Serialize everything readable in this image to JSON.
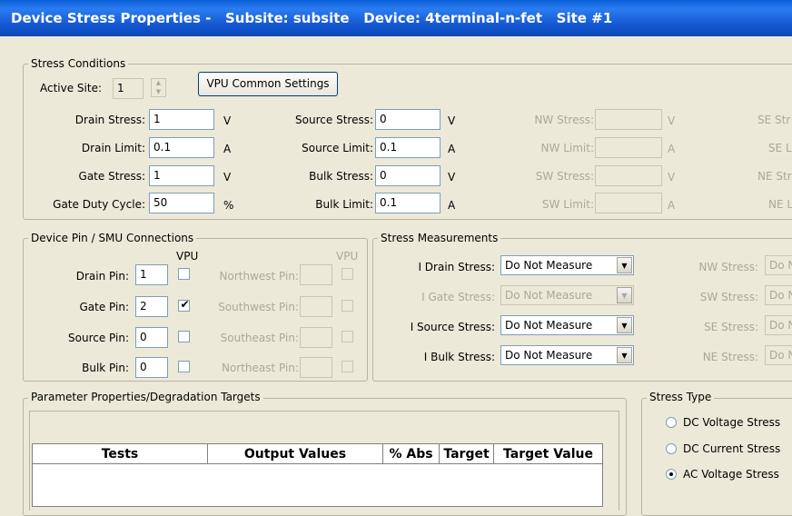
{
  "window": {
    "title": "Device Stress Properties -   Subsite: subsite   Device: 4terminal-n-fet   Site #1"
  },
  "stress_conditions": {
    "legend": "Stress Conditions",
    "active_site_label": "Active Site:",
    "active_site_value": "1",
    "vpu_button": "VPU Common Settings",
    "rows": [
      {
        "label": "Drain Stress:",
        "value": "1",
        "unit": "V"
      },
      {
        "label": "Drain Limit:",
        "value": "0.1",
        "unit": "A"
      },
      {
        "label": "Gate Stress:",
        "value": "1",
        "unit": "V"
      },
      {
        "label": "Gate Duty Cycle:",
        "value": "50",
        "unit": "%"
      }
    ],
    "rows2": [
      {
        "label": "Source Stress:",
        "value": "0",
        "unit": "V"
      },
      {
        "label": "Source Limit:",
        "value": "0.1",
        "unit": "A"
      },
      {
        "label": "Bulk Stress:",
        "value": "0",
        "unit": "V"
      },
      {
        "label": "Bulk Limit:",
        "value": "0.1",
        "unit": "A"
      }
    ],
    "rows3": [
      {
        "label": "NW Stress:",
        "unit": "V"
      },
      {
        "label": "NW Limit:",
        "unit": "A"
      },
      {
        "label": "SW Stress:",
        "unit": "V"
      },
      {
        "label": "SW Limit:",
        "unit": "A"
      }
    ],
    "rows4": [
      "SE Str",
      "SE L",
      "NE Str",
      "NE L"
    ]
  },
  "pins": {
    "legend": "Device Pin / SMU Connections",
    "vpu_header": "VPU",
    "vpu_header2": "VPU",
    "rows": [
      {
        "label": "Drain Pin:",
        "value": "1",
        "vpu": false
      },
      {
        "label": "Gate Pin:",
        "value": "2",
        "vpu": true
      },
      {
        "label": "Source Pin:",
        "value": "0",
        "vpu": false
      },
      {
        "label": "Bulk Pin:",
        "value": "0",
        "vpu": false
      }
    ],
    "rows2": [
      "Northwest Pin:",
      "Southwest Pin:",
      "Southeast Pin:",
      "Northeast Pin:"
    ],
    "check_mark": "✔"
  },
  "measurements": {
    "legend": "Stress Measurements",
    "rows": [
      {
        "label": "I Drain Stress:",
        "value": "Do Not Measure",
        "enabled": true
      },
      {
        "label": "I Gate Stress:",
        "value": "Do Not Measure",
        "enabled": false
      },
      {
        "label": "I Source Stress:",
        "value": "Do Not Measure",
        "enabled": true
      },
      {
        "label": "I Bulk Stress:",
        "value": "Do Not Measure",
        "enabled": true
      }
    ],
    "rows2": [
      {
        "label": "NW Stress:",
        "value": "Do N"
      },
      {
        "label": "SW Stress:",
        "value": "Do N"
      },
      {
        "label": "SE Stress:",
        "value": "Do N"
      },
      {
        "label": "NE Stress:",
        "value": "Do N"
      }
    ],
    "arrow": "▼"
  },
  "parameters": {
    "legend": "Parameter Properties/Degradation Targets",
    "columns": [
      "Tests",
      "Output Values",
      "% Abs",
      "Target",
      "Target Value"
    ]
  },
  "stress_type": {
    "legend": "Stress Type",
    "options": [
      {
        "label": "DC Voltage Stress",
        "selected": false
      },
      {
        "label": "DC Current Stress",
        "selected": false
      },
      {
        "label": "AC Voltage Stress",
        "selected": true
      }
    ]
  }
}
